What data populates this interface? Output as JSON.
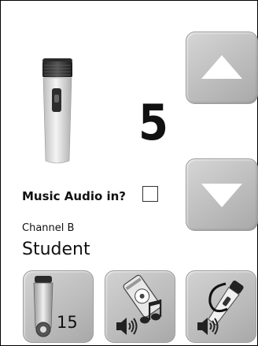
{
  "panel": {
    "channel_number": "5",
    "music_audio_label": "Music Audio in?",
    "music_audio_checked": false,
    "channel_label": "Channel B",
    "channel_value": "Student"
  },
  "buttons": {
    "up_icon": "triangle-up-icon",
    "down_icon": "triangle-down-icon"
  },
  "tools": {
    "mic_volume_badge": "15",
    "mic_volume_icon": "microphone-volume-icon",
    "music_audio_icon": "music-audio-icon",
    "mic_audio_icon": "handheld-mic-audio-icon"
  }
}
